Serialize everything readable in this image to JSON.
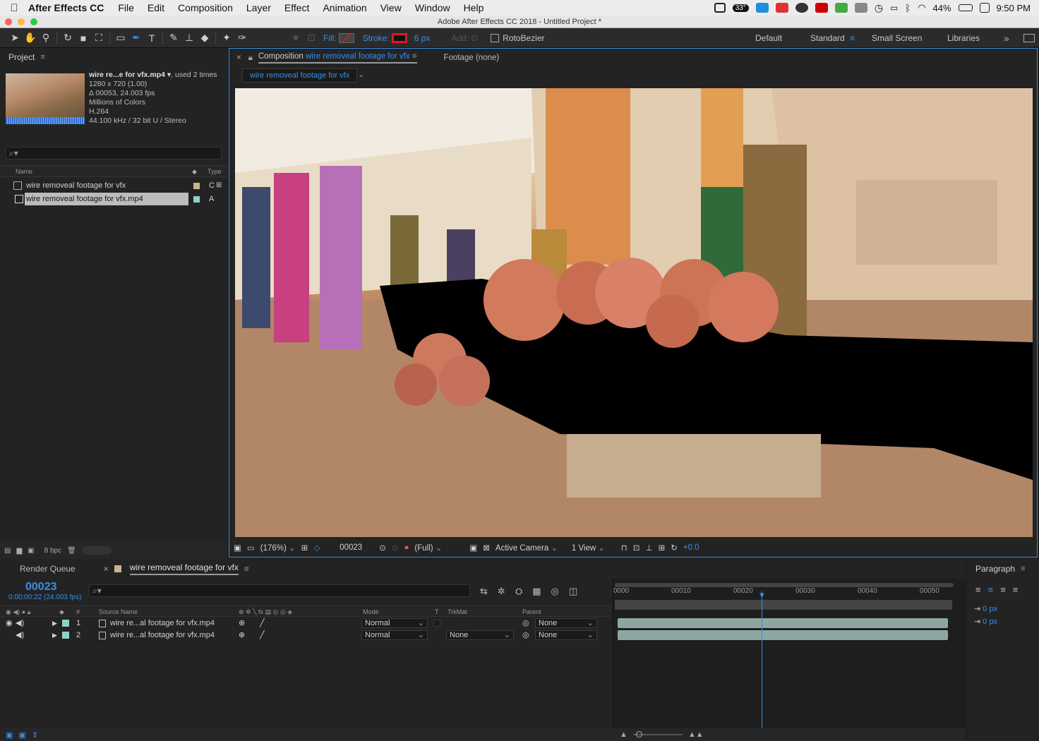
{
  "menubar": {
    "app": "After Effects CC",
    "items": [
      "File",
      "Edit",
      "Composition",
      "Layer",
      "Effect",
      "Animation",
      "View",
      "Window",
      "Help"
    ],
    "temp": "33°",
    "battery": "44%",
    "time": "9:50 PM"
  },
  "window": {
    "title": "Adobe After Effects CC 2018 - Untitled Project *"
  },
  "toolbar": {
    "fill_label": "Fill:",
    "stroke_label": "Stroke:",
    "stroke_width": "6 px",
    "add_label": "Add:",
    "rotobezier": "RotoBezier",
    "workspaces": [
      "Default",
      "Standard",
      "Small Screen",
      "Libraries"
    ],
    "more": "»",
    "accent": "#3a8ee6",
    "stroke_color": "#d41c1c"
  },
  "project": {
    "title": "Project",
    "file": {
      "name": "wire re...e for vfx.mp4",
      "used": ", used 2 times",
      "resolution": "1280 x 720 (1.00)",
      "duration": "Δ 00053, 24.003 fps",
      "colors": "Millions of Colors",
      "codec": "H.264",
      "audio": "44.100 kHz / 32 bit U / Stereo"
    },
    "search_glyph": "⌕▾",
    "columns": {
      "name": "Name",
      "type": "Type"
    },
    "items": [
      {
        "name": "wire removeal footage for vfx",
        "type": "C",
        "color": "#c9b48a"
      },
      {
        "name": "wire removeal footage for vfx.mp4",
        "type": "A",
        "color": "#8fd1c9"
      }
    ],
    "bpc": "8 bpc"
  },
  "comp": {
    "tab_prefix": "Composition",
    "tab_name": "wire removeal footage for vfx",
    "footage_tab": "Footage (none)",
    "subtab": "wire removeal footage for vfx",
    "zoom": "(176%)",
    "frame": "00023",
    "resolution": "(Full)",
    "camera": "Active Camera",
    "views": "1 View",
    "exposure": "+0.0"
  },
  "timeline": {
    "render_queue": "Render Queue",
    "tab": "wire removeal footage for vfx",
    "timecode": "00023",
    "time_sub": "0:00:00:22 (24.003 fps)",
    "columns": {
      "hash": "#",
      "source": "Source Name",
      "mode": "Mode",
      "t": "T",
      "trkmat": "TrkMat",
      "parent": "Parent"
    },
    "layers": [
      {
        "num": "1",
        "name": "wire re...al footage for vfx.mp4",
        "mode": "Normal",
        "trkmat": "",
        "parent": "None"
      },
      {
        "num": "2",
        "name": "wire re...al footage for vfx.mp4",
        "mode": "Normal",
        "trkmat": "None",
        "parent": "None"
      }
    ],
    "ruler": [
      "0000",
      "00010",
      "00020",
      "00030",
      "00040",
      "00050"
    ]
  },
  "paragraph": {
    "title": "Paragraph",
    "indent1": "0 px",
    "indent2": "0 px"
  }
}
